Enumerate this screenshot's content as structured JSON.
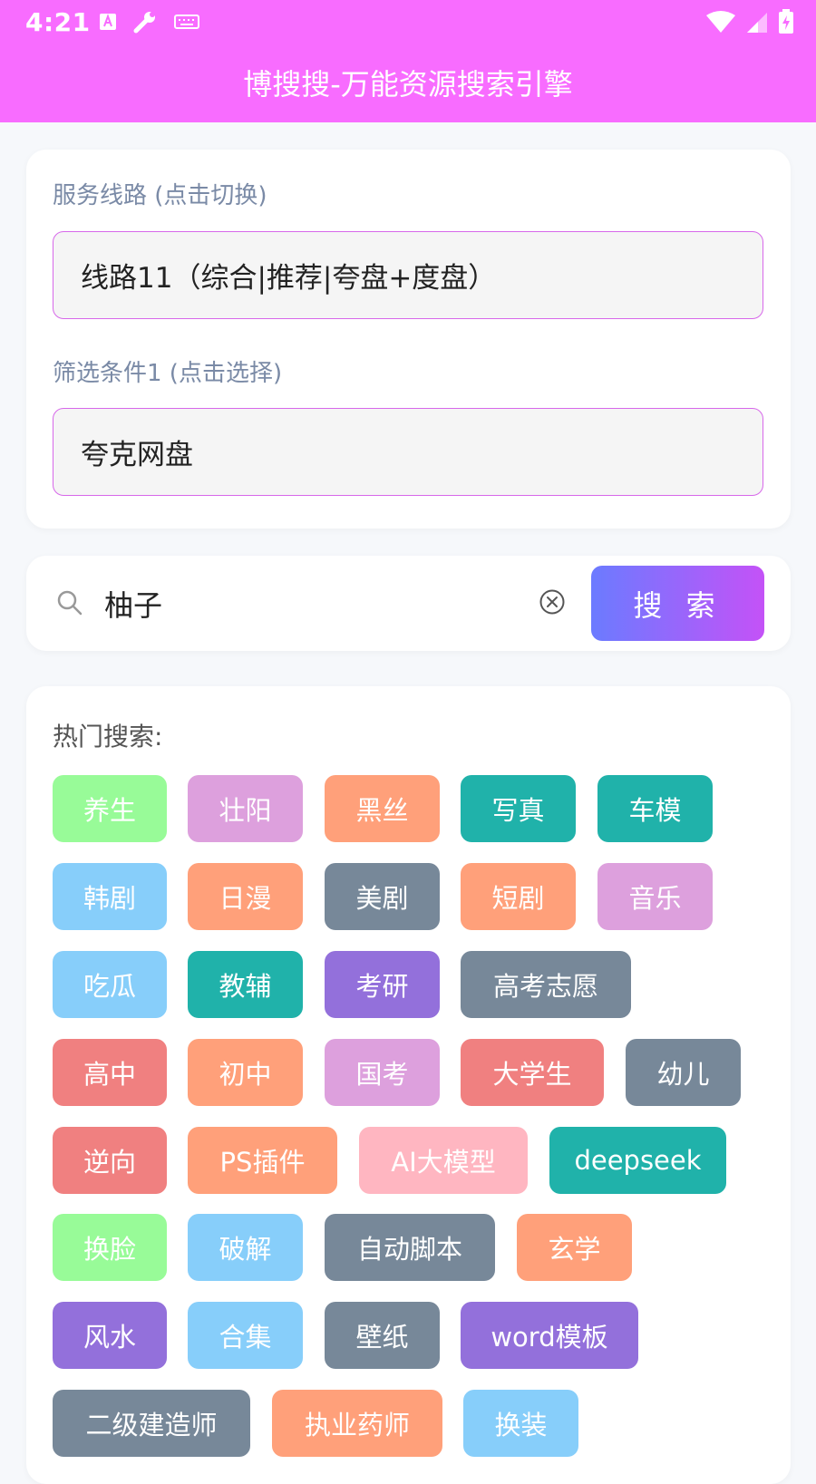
{
  "status": {
    "time": "4:21"
  },
  "header": {
    "title": "博搜搜-万能资源搜索引擎"
  },
  "settings": {
    "route_label": "服务线路 (点击切换)",
    "route_value": "线路11（综合|推荐|夸盘+度盘）",
    "filter_label": "筛选条件1 (点击选择)",
    "filter_value": "夸克网盘"
  },
  "search": {
    "query": "柚子",
    "button_label": "搜 索"
  },
  "hot": {
    "title": "热门搜索:",
    "tags": [
      {
        "label": "养生",
        "color": "#98fb98"
      },
      {
        "label": "壮阳",
        "color": "#dda0dd"
      },
      {
        "label": "黑丝",
        "color": "#ffa07a"
      },
      {
        "label": "写真",
        "color": "#20b2aa"
      },
      {
        "label": "车模",
        "color": "#20b2aa"
      },
      {
        "label": "韩剧",
        "color": "#87cefa"
      },
      {
        "label": "日漫",
        "color": "#ffa07a"
      },
      {
        "label": "美剧",
        "color": "#778899"
      },
      {
        "label": "短剧",
        "color": "#ffa07a"
      },
      {
        "label": "音乐",
        "color": "#dda0dd"
      },
      {
        "label": "吃瓜",
        "color": "#87cefa"
      },
      {
        "label": "教辅",
        "color": "#20b2aa"
      },
      {
        "label": "考研",
        "color": "#9370db"
      },
      {
        "label": "高考志愿",
        "color": "#778899"
      },
      {
        "label": "高中",
        "color": "#f08080"
      },
      {
        "label": "初中",
        "color": "#ffa07a"
      },
      {
        "label": "国考",
        "color": "#dda0dd"
      },
      {
        "label": "大学生",
        "color": "#f08080"
      },
      {
        "label": "幼儿",
        "color": "#778899"
      },
      {
        "label": "逆向",
        "color": "#f08080"
      },
      {
        "label": "PS插件",
        "color": "#ffa07a"
      },
      {
        "label": "AI大模型",
        "color": "#ffb6c1"
      },
      {
        "label": "deepseek",
        "color": "#20b2aa"
      },
      {
        "label": "换脸",
        "color": "#98fb98"
      },
      {
        "label": "破解",
        "color": "#87cefa"
      },
      {
        "label": "自动脚本",
        "color": "#778899"
      },
      {
        "label": "玄学",
        "color": "#ffa07a"
      },
      {
        "label": "风水",
        "color": "#9370db"
      },
      {
        "label": "合集",
        "color": "#87cefa"
      },
      {
        "label": "壁纸",
        "color": "#778899"
      },
      {
        "label": "word模板",
        "color": "#9370db"
      },
      {
        "label": "二级建造师",
        "color": "#778899"
      },
      {
        "label": "执业药师",
        "color": "#ffa07a"
      },
      {
        "label": "换装",
        "color": "#87cefa"
      }
    ]
  }
}
